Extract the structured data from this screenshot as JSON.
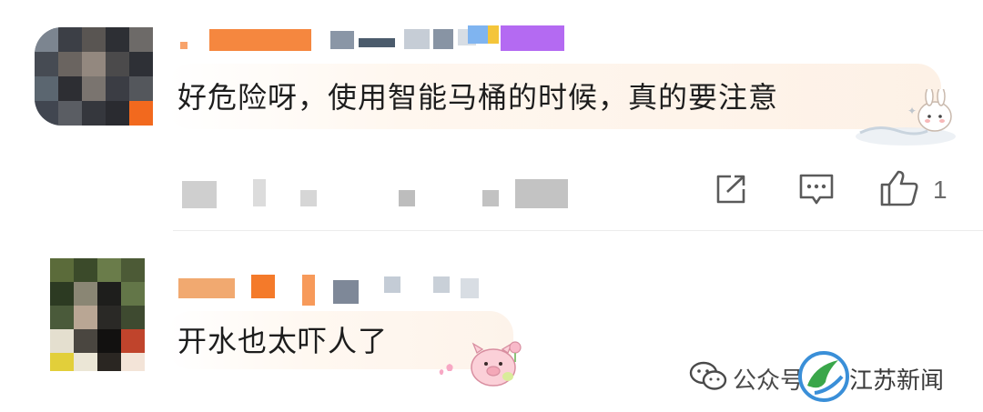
{
  "comments": [
    {
      "text": "好危险呀，使用智能马桶的时候，真的要注意",
      "actions": {
        "share_icon": "share-icon",
        "reply_icon": "reply-icon",
        "like_icon": "thumbs-up-icon",
        "like_count": "1"
      }
    },
    {
      "text": "开水也太吓人了"
    }
  ],
  "watermark": {
    "channel_label": "公众号",
    "publisher": "江苏新闻",
    "brand_color": "#3a8fd8"
  },
  "colors": {
    "bubble_1": "#fdf1e6",
    "bubble_2": "#fdf3ea",
    "username_orange": "#f47a2a",
    "divider": "#ececec",
    "action_gray": "#5a5a5a"
  }
}
